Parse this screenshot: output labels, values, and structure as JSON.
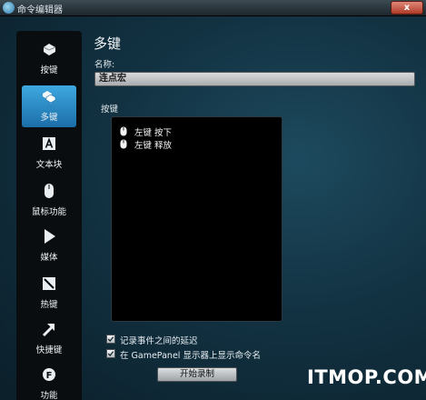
{
  "window": {
    "title": "命令编辑器",
    "close_label": "x"
  },
  "sidebar": {
    "items": [
      {
        "label": "按键",
        "icon": "keyboard-key-icon",
        "active": false
      },
      {
        "label": "多键",
        "icon": "multi-key-icon",
        "active": true
      },
      {
        "label": "文本块",
        "icon": "text-block-icon",
        "active": false
      },
      {
        "label": "鼠标功能",
        "icon": "mouse-icon",
        "active": false
      },
      {
        "label": "媒体",
        "icon": "play-icon",
        "active": false
      },
      {
        "label": "热键",
        "icon": "hotkey-icon",
        "active": false
      },
      {
        "label": "快捷键",
        "icon": "shortcut-arrow-icon",
        "active": false
      },
      {
        "label": "功能",
        "icon": "gear-icon",
        "active": false
      }
    ]
  },
  "main": {
    "heading": "多键",
    "name_label": "名称:",
    "name_value": "连点宏",
    "keys_label": "按键",
    "key_events": [
      {
        "text": "左键 按下",
        "icon": "mouse-icon"
      },
      {
        "text": "左键 释放",
        "icon": "mouse-icon"
      }
    ],
    "options": [
      {
        "label": "记录事件之间的延迟",
        "checked": true
      },
      {
        "label": "在 GamePanel 显示器上显示命令名",
        "checked": true
      }
    ],
    "record_button": "开始录制"
  },
  "watermark": "ITMOP.COM",
  "colors": {
    "accent": "#2a8fd0",
    "background": "#123242"
  }
}
